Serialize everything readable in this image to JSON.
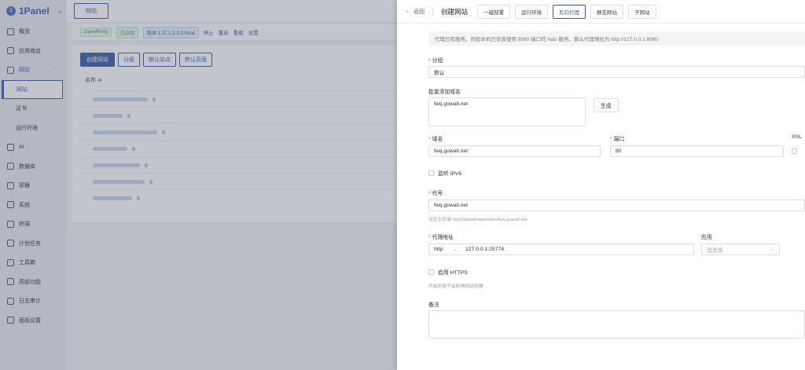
{
  "app": {
    "logo_text": "1Panel",
    "collapse_icon": "chevron-left-icon"
  },
  "sidebar": {
    "items": [
      {
        "label": "概览",
        "icon": "home-icon"
      },
      {
        "label": "应用商店",
        "icon": "grid-icon"
      },
      {
        "label": "网站",
        "icon": "globe-icon",
        "expanded": true,
        "children": [
          "网站",
          "证书",
          "运行环境"
        ]
      },
      {
        "label": "AI",
        "icon": "ai-icon",
        "chevron": true
      },
      {
        "label": "数据库",
        "icon": "database-icon"
      },
      {
        "label": "容器",
        "icon": "container-icon"
      },
      {
        "label": "系统",
        "icon": "system-icon",
        "chevron": true
      },
      {
        "label": "终端",
        "icon": "terminal-icon"
      },
      {
        "label": "计划任务",
        "icon": "calendar-icon"
      },
      {
        "label": "工具箱",
        "icon": "toolbox-icon"
      },
      {
        "label": "高级功能",
        "icon": "diamond-icon",
        "chevron": true
      },
      {
        "label": "日志审计",
        "icon": "log-icon"
      },
      {
        "label": "面板设置",
        "icon": "gear-icon"
      }
    ]
  },
  "main": {
    "top_tab": "网站",
    "status": {
      "app_name": "OpenResty",
      "state": "已启动",
      "version": "版本:1.27.1.2-2-2-focal",
      "actions": [
        "停止",
        "重启",
        "重载",
        "设置"
      ]
    },
    "buttons": {
      "create": "创建网站",
      "group": "分组",
      "default_site": "默认站点",
      "default_page": "默认页面"
    },
    "table": {
      "col_name": "名称 ≑",
      "row_count": 7
    }
  },
  "drawer": {
    "back_label": "返回",
    "title": "创建网站",
    "tabs": [
      "一键部署",
      "运行环境",
      "反向代理",
      "静态网站",
      "子网站"
    ],
    "active_tab": "反向代理",
    "alert": "代理已有服务。例如本机已安装使用 8080 端口的 halo 服务，那么代理地址为 http://127.0.0.1:8080",
    "group": {
      "label": "分组",
      "value": "默认"
    },
    "batch_domains": {
      "label": "批量添加域名",
      "value": "fwq.gowall.net",
      "generate_btn": "生成"
    },
    "domain": {
      "label": "域名",
      "value": "fwq.gowall.net"
    },
    "port": {
      "label": "端口",
      "value": "80"
    },
    "ssl": {
      "label": "SSL"
    },
    "ipv6": {
      "label": "监听 IPV6"
    },
    "alias": {
      "label": "代号",
      "value": "fwq.gowall.net",
      "help": "对应主目录:/opt/1panel/www/sites/fwq.gowall.net"
    },
    "proxy": {
      "label": "代理地址",
      "protocol": "http",
      "address": "127.0.0.1:25774"
    },
    "app": {
      "label": "应用",
      "placeholder": "请选择"
    },
    "https": {
      "label": "启用 HTTPS",
      "help": "开启失败不会影响网站创建"
    },
    "remark": {
      "label": "备注"
    }
  }
}
